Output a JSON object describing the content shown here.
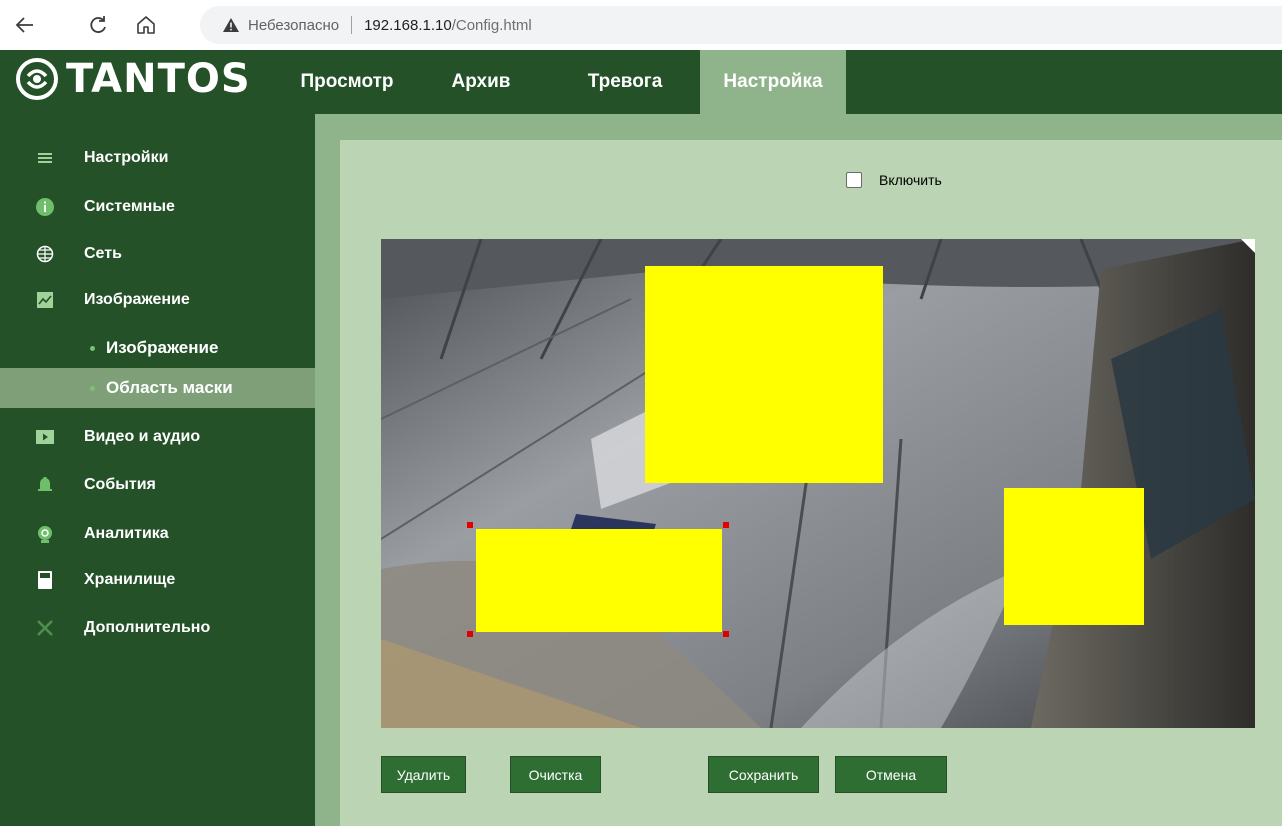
{
  "browser": {
    "security_label": "Небезопасно",
    "url_host": "192.168.1.10",
    "url_path": "/Config.html"
  },
  "header": {
    "logo_text": "TANTOS",
    "tabs": [
      {
        "label": "Просмотр",
        "active": false
      },
      {
        "label": "Архив",
        "active": false
      },
      {
        "label": "Тревога",
        "active": false
      },
      {
        "label": "Настройка",
        "active": true
      }
    ]
  },
  "sidebar": {
    "items": [
      {
        "label": "Настройки",
        "icon": "list-icon"
      },
      {
        "label": "Системные",
        "icon": "info-icon"
      },
      {
        "label": "Сеть",
        "icon": "globe-icon"
      },
      {
        "label": "Изображение",
        "icon": "image-icon"
      },
      {
        "label": "Видео и аудио",
        "icon": "video-icon"
      },
      {
        "label": "События",
        "icon": "bell-icon"
      },
      {
        "label": "Аналитика",
        "icon": "analytics-icon"
      },
      {
        "label": "Хранилище",
        "icon": "storage-icon"
      },
      {
        "label": "Дополнительно",
        "icon": "tools-icon"
      }
    ],
    "sub_items": [
      {
        "label": "Изображение",
        "active": false
      },
      {
        "label": "Область маски",
        "active": true
      }
    ]
  },
  "mask_settings": {
    "enable_label": "Включить",
    "enabled": false,
    "mask_color": "#ffff00"
  },
  "buttons": {
    "delete": "Удалить",
    "clear": "Очистка",
    "save": "Сохранить",
    "cancel": "Отмена"
  },
  "colors": {
    "header_bg": "#245128",
    "active_tab": "#8fb38b",
    "panel_bg": "#bad4b4",
    "button_bg": "#2f6e32"
  }
}
